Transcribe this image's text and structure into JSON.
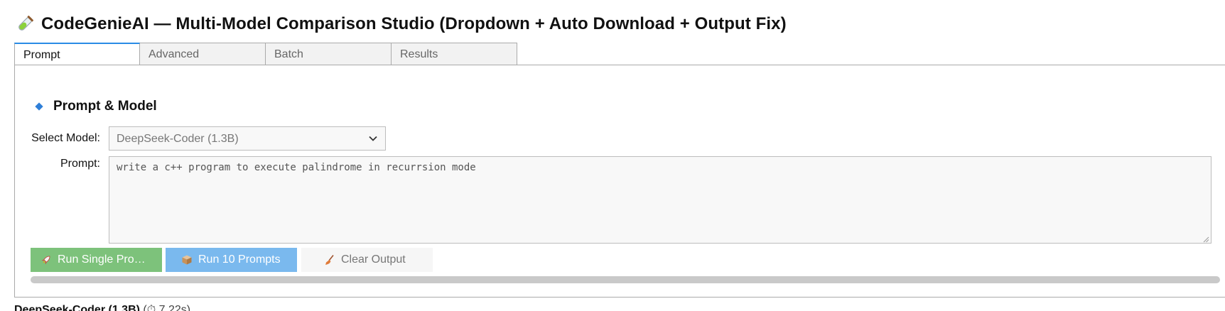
{
  "app": {
    "title": "CodeGenieAI — Multi-Model Comparison Studio (Dropdown + Auto Download + Output Fix)",
    "title_icon": "test-tube-icon"
  },
  "tabs": [
    {
      "label": "Prompt",
      "active": true
    },
    {
      "label": "Advanced",
      "active": false
    },
    {
      "label": "Batch",
      "active": false
    },
    {
      "label": "Results",
      "active": false
    }
  ],
  "section": {
    "title": "Prompt & Model",
    "icon": "blue-diamond-icon"
  },
  "model": {
    "label": "Select Model:",
    "selected": "DeepSeek-Coder (1.3B)"
  },
  "prompt": {
    "label": "Prompt:",
    "value": "write a c++ program to execute palindrome in recurrsion mode"
  },
  "buttons": {
    "run_single": "Run Single Pro…",
    "run_batch": "Run 10 Prompts",
    "clear": "Clear Output"
  },
  "progress": {
    "fraction": 1.0
  },
  "result": {
    "model": "DeepSeek-Coder (1.3B)",
    "time": "(⏱ 7.22s)"
  },
  "colors": {
    "accent": "#2a8ce6",
    "run_single_bg": "#7dc27b",
    "run_batch_bg": "#7ab9ee",
    "section_diamond": "#2f7fd8"
  }
}
